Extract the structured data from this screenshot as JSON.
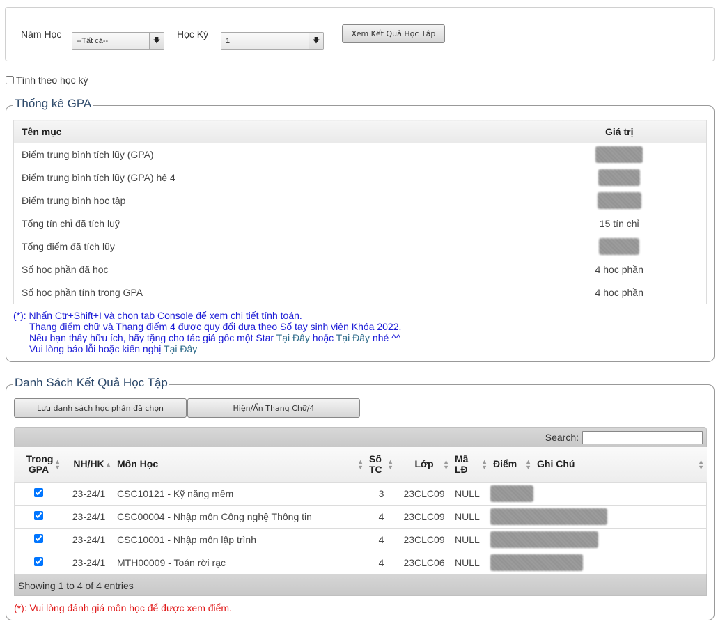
{
  "filter": {
    "year_label": "Năm Học",
    "year_value": "--Tất cả--",
    "semester_label": "Học Kỳ",
    "semester_value": "1",
    "view_button": "Xem Kết Quả Học Tập"
  },
  "semester_toggle": {
    "label": "Tính theo học kỳ",
    "checked": false
  },
  "gpa_section": {
    "legend": "Thống kê GPA",
    "headers": {
      "name": "Tên mục",
      "value": "Giá trị"
    },
    "rows": [
      {
        "name": "Điểm trung bình tích lũy (GPA)",
        "value": "",
        "redacted": true
      },
      {
        "name": "Điểm trung bình tích lũy (GPA) hệ 4",
        "value": "",
        "redacted": true
      },
      {
        "name": "Điểm trung bình học tập",
        "value": "",
        "redacted": true
      },
      {
        "name": "Tổng tín chỉ đã tích luỹ",
        "value": "15 tín chỉ",
        "redacted": false
      },
      {
        "name": "Tổng điểm đã tích lũy",
        "value": "",
        "redacted": true
      },
      {
        "name": "Số học phần đã học",
        "value": "4 học phần",
        "redacted": false
      },
      {
        "name": "Số học phần tính trong GPA",
        "value": "4 học phần",
        "redacted": false
      }
    ],
    "notes": {
      "star": "(*)",
      "line1": ": Nhấn Ctr+Shift+I và chọn tab Console để xem chi tiết tính toán.",
      "line2": "Thang điểm chữ và Thang điểm 4 được quy đổi dựa theo Sổ tay sinh viên Khóa 2022.",
      "line3_pre": "Nếu bạn thấy hữu ích, hãy tặng cho tác giả gốc một Star ",
      "line3_link1": "Tại Đây",
      "line3_mid": " hoặc ",
      "line3_link2": "Tại Đây",
      "line3_post": " nhé ^^",
      "line4_pre": "Vui lòng báo lỗi hoặc kiến nghị ",
      "line4_link": "Tại Đây"
    }
  },
  "results_section": {
    "legend": "Danh Sách Kết Quả Học Tập",
    "save_button": "Lưu danh sách học phần đã chọn",
    "toggle_button": "Hiện/Ẩn Thang Chữ/4",
    "search_label": "Search:",
    "search_value": "",
    "headers": {
      "in_gpa": "Trong GPA",
      "term": "NH/HK",
      "course": "Môn Học",
      "credits": "Số TC",
      "class": "Lớp",
      "code": "Mã LĐ",
      "grade": "Điểm",
      "note": "Ghi Chú"
    },
    "rows": [
      {
        "checked": true,
        "term": "23-24/1",
        "course": "CSC10121 - Kỹ năng mềm",
        "credits": "3",
        "class": "23CLC09",
        "code": "NULL"
      },
      {
        "checked": true,
        "term": "23-24/1",
        "course": "CSC00004 - Nhập môn Công nghệ Thông tin",
        "credits": "4",
        "class": "23CLC09",
        "code": "NULL"
      },
      {
        "checked": true,
        "term": "23-24/1",
        "course": "CSC10001 - Nhập môn lập trình",
        "credits": "4",
        "class": "23CLC09",
        "code": "NULL"
      },
      {
        "checked": true,
        "term": "23-24/1",
        "course": "MTH00009 - Toán rời rạc",
        "credits": "4",
        "class": "23CLC06",
        "code": "NULL"
      }
    ],
    "footer": "Showing 1 to 4 of 4 entries",
    "note_star": "(*)",
    "note_text": ": Vui lòng đánh giá môn học để được xem điểm."
  },
  "colors": {
    "legend": "#2e4a6b",
    "notes_blue": "#1a1ad6",
    "link": "#2e6b8a",
    "warning_red": "#e01818"
  }
}
